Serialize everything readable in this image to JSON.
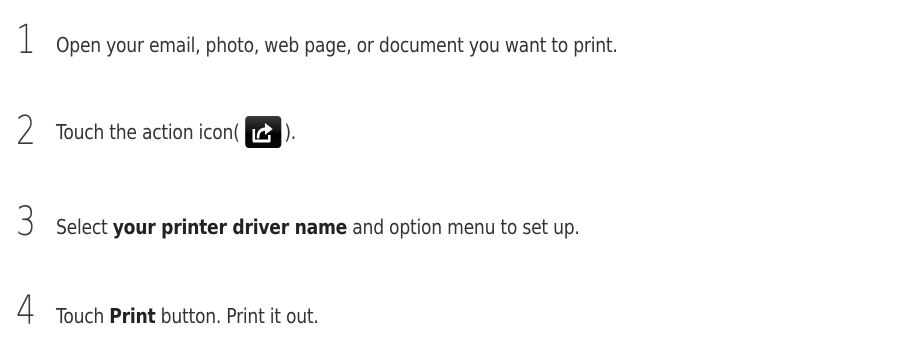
{
  "steps": [
    {
      "number": "1",
      "text": "Open your email, photo, web page, or document you want to print."
    },
    {
      "number": "2",
      "text_before": "Touch the action icon(",
      "icon": "share-action-icon",
      "text_after": ")."
    },
    {
      "number": "3",
      "text_before": "Select ",
      "bold": "your printer driver name",
      "text_after": " and option menu to set up."
    },
    {
      "number": "4",
      "text_before": "Touch ",
      "bold": "Print",
      "text_after": " button. Print it out."
    }
  ],
  "colors": {
    "text": "#333333",
    "icon_background": "#000000",
    "icon_glyph": "#ffffff"
  }
}
